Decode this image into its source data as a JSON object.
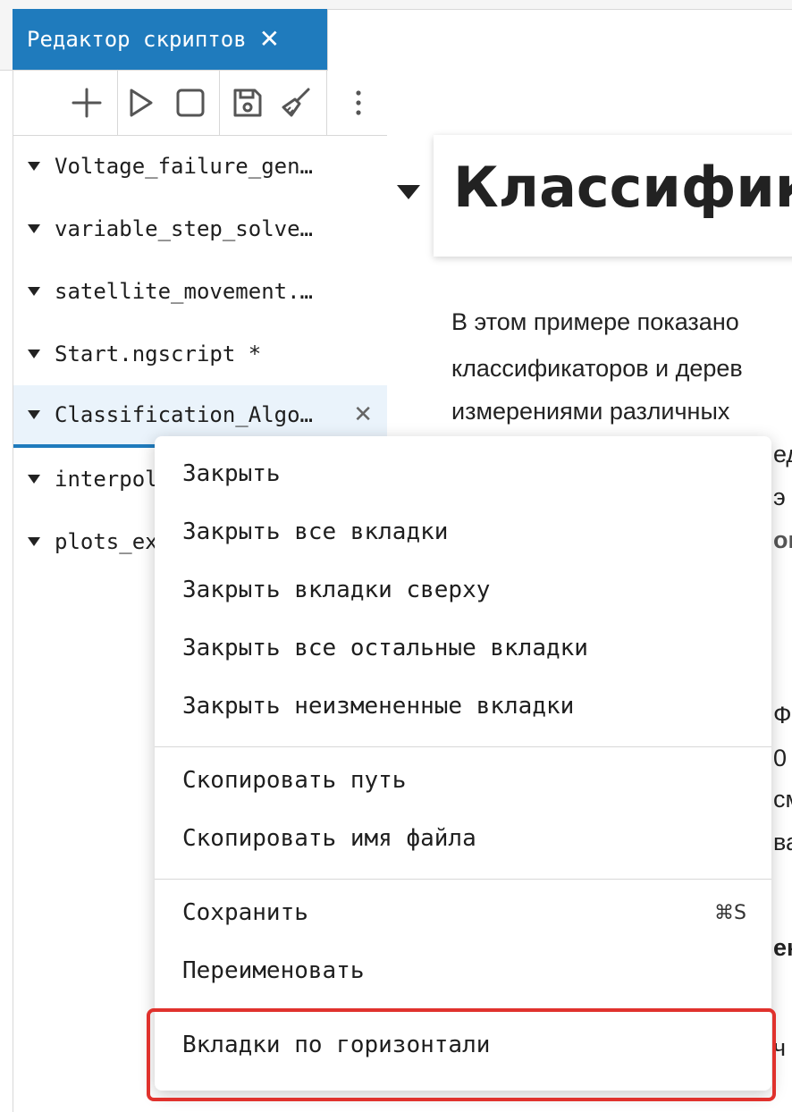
{
  "tabs": {
    "active_label": "Редактор скриптов",
    "close_glyph": "✕"
  },
  "toolbar": {
    "add_icon": "plus-icon",
    "run_icon": "play-icon",
    "stop_icon": "stop-icon",
    "save_icon": "save-icon",
    "clean_icon": "brush-icon",
    "more_icon": "more-vertical-icon"
  },
  "files": [
    {
      "label": "Voltage_failure_gen…"
    },
    {
      "label": "variable_step_solve…"
    },
    {
      "label": "satellite_movement.…"
    },
    {
      "label": "Start.ngscript *"
    },
    {
      "label": "Classification_Algo…",
      "selected": true,
      "close": "✕"
    },
    {
      "label": "interpol"
    },
    {
      "label": "plots_ex"
    }
  ],
  "document": {
    "heading": "Классифика",
    "para_line1": "В этом примере показано",
    "para_line2": "классификаторов и дерев",
    "para_line3": "измерениями различных",
    "frag_1": "ед",
    "frag_2": "э",
    "frag_3": "он",
    "frag_4": "Фі",
    "frag_5": "0",
    "frag_6": "см",
    "frag_7": "ва",
    "frag_8": "ек",
    "frag_9": "ч"
  },
  "context_menu": {
    "close": "Закрыть",
    "close_all": "Закрыть все вкладки",
    "close_above": "Закрыть вкладки сверху",
    "close_others": "Закрыть все остальные вкладки",
    "close_unmodified": "Закрыть неизмененные вкладки",
    "copy_path": "Скопировать путь",
    "copy_filename": "Скопировать имя файла",
    "save": "Сохранить",
    "save_shortcut": "⌘S",
    "rename": "Переименовать",
    "tabs_horizontal": "Вкладки по горизонтали"
  },
  "colors": {
    "accent": "#1f7bbd",
    "highlight": "#e0322d"
  }
}
